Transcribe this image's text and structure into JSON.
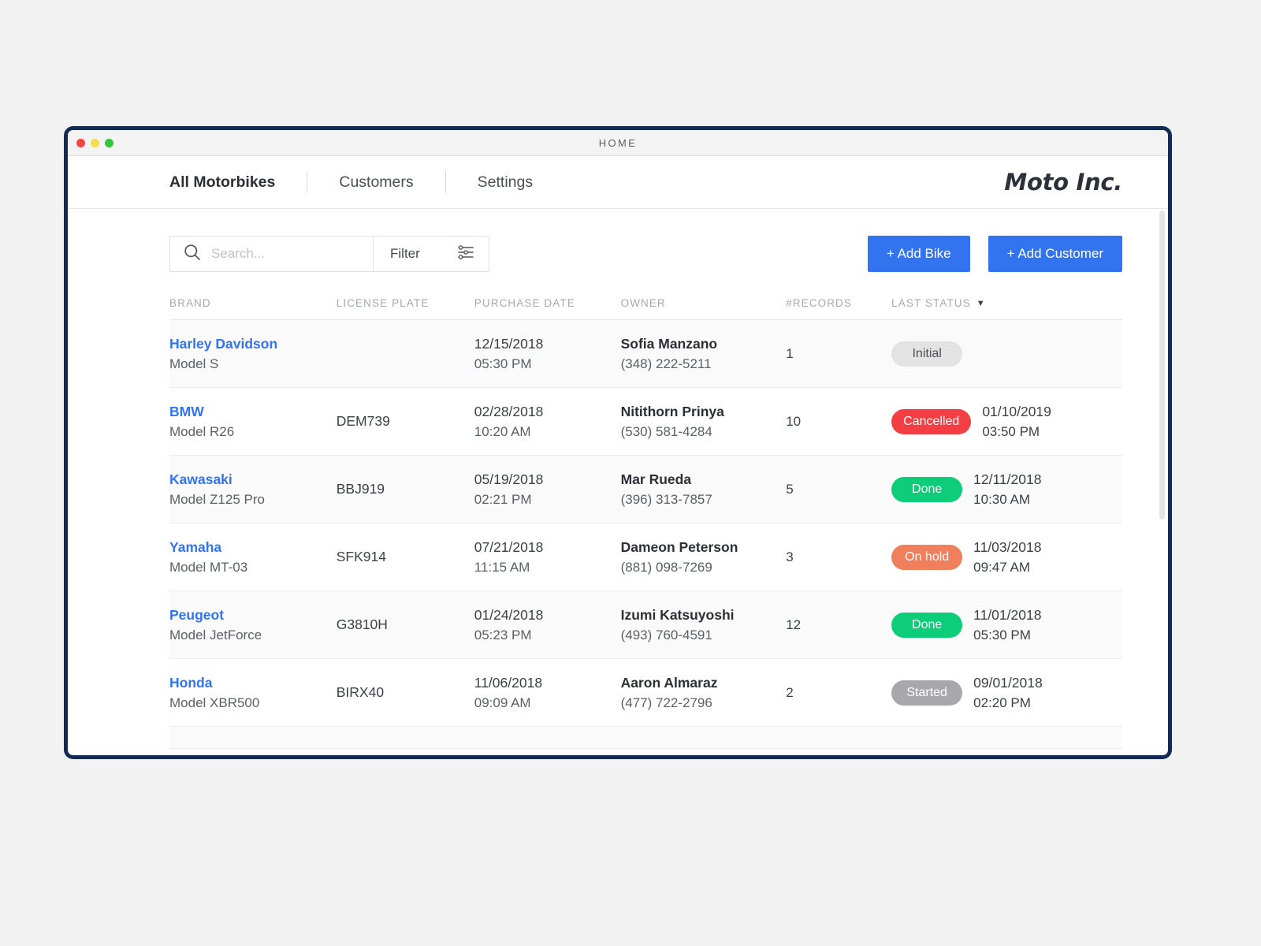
{
  "window": {
    "title": "HOME",
    "traffic_lights": [
      "close",
      "minimize",
      "maximize"
    ],
    "accent_border": "#142a55"
  },
  "nav": {
    "items": [
      {
        "label": "All Motorbikes",
        "active": true
      },
      {
        "label": "Customers",
        "active": false
      },
      {
        "label": "Settings",
        "active": false
      }
    ],
    "logo": "Moto Inc."
  },
  "toolbar": {
    "search_placeholder": "Search...",
    "search_value": "",
    "filter_label": "Filter",
    "add_bike_label": "+ Add Bike",
    "add_customer_label": "+ Add Customer",
    "primary_color": "#3274f0"
  },
  "table": {
    "columns": [
      "BRAND",
      "LICENSE PLATE",
      "PURCHASE DATE",
      "OWNER",
      "#RECORDS",
      "LAST STATUS"
    ],
    "sorted_column": "LAST STATUS",
    "sort_direction": "desc",
    "rows": [
      {
        "brand": "Harley Davidson",
        "model": "Model S",
        "plate": "",
        "purchase_date": "12/15/2018",
        "purchase_time": "05:30 PM",
        "owner": "Sofia Manzano",
        "phone": "(348) 222-5211",
        "records": "1",
        "status": "Initial",
        "status_style": "initial",
        "status_date": "",
        "status_time": ""
      },
      {
        "brand": "BMW",
        "model": "Model R26",
        "plate": "DEM739",
        "purchase_date": "02/28/2018",
        "purchase_time": "10:20 AM",
        "owner": "Nitithorn Prinya",
        "phone": "(530) 581-4284",
        "records": "10",
        "status": "Cancelled",
        "status_style": "cancelled",
        "status_date": "01/10/2019",
        "status_time": "03:50 PM"
      },
      {
        "brand": "Kawasaki",
        "model": "Model Z125 Pro",
        "plate": "BBJ919",
        "purchase_date": "05/19/2018",
        "purchase_time": "02:21 PM",
        "owner": "Mar Rueda",
        "phone": "(396) 313-7857",
        "records": "5",
        "status": "Done",
        "status_style": "done",
        "status_date": "12/11/2018",
        "status_time": "10:30 AM"
      },
      {
        "brand": "Yamaha",
        "model": "Model MT-03",
        "plate": "SFK914",
        "purchase_date": "07/21/2018",
        "purchase_time": "11:15 AM",
        "owner": "Dameon Peterson",
        "phone": "(881) 098-7269",
        "records": "3",
        "status": "On hold",
        "status_style": "onhold",
        "status_date": "11/03/2018",
        "status_time": "09:47 AM"
      },
      {
        "brand": "Peugeot",
        "model": "Model JetForce",
        "plate": "G3810H",
        "purchase_date": "01/24/2018",
        "purchase_time": "05:23 PM",
        "owner": "Izumi Katsuyoshi",
        "phone": "(493) 760-4591",
        "records": "12",
        "status": "Done",
        "status_style": "done",
        "status_date": "11/01/2018",
        "status_time": "05:30 PM"
      },
      {
        "brand": "Honda",
        "model": "Model XBR500",
        "plate": "BIRX40",
        "purchase_date": "11/06/2018",
        "purchase_time": "09:09 AM",
        "owner": "Aaron Almaraz",
        "phone": "(477) 722-2796",
        "records": "2",
        "status": "Started",
        "status_style": "started",
        "status_date": "09/01/2018",
        "status_time": "02:20 PM"
      }
    ]
  },
  "status_colors": {
    "initial": "#e3e3e3",
    "cancelled": "#f33f44",
    "done": "#0ecd79",
    "onhold": "#f0805d",
    "started": "#a8a8ab"
  }
}
